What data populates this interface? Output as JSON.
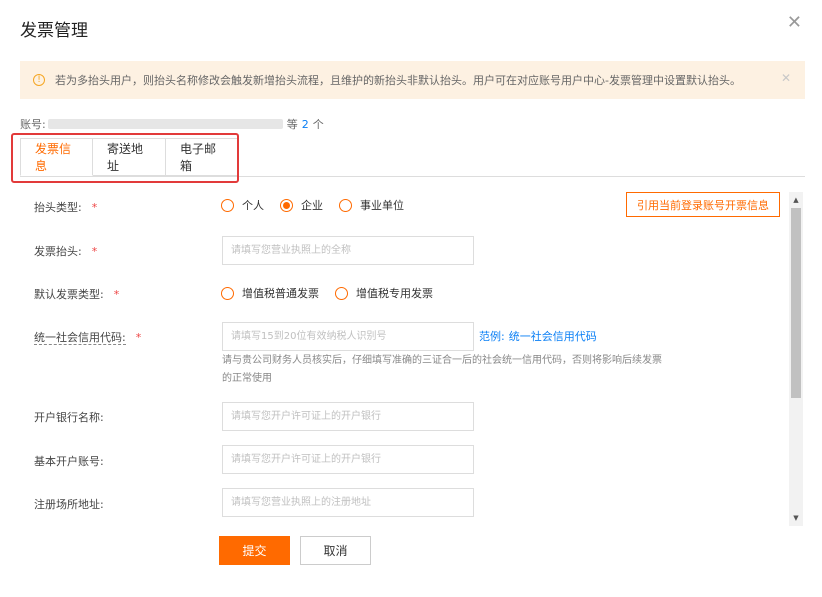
{
  "dialog": {
    "title": "发票管理"
  },
  "alert": {
    "text": "若为多抬头用户，则抬头名称修改会触发新增抬头流程，且维护的新抬头非默认抬头。用户可在对应账号用户中心-发票管理中设置默认抬头。"
  },
  "account": {
    "label": "账号:",
    "suffix_prefix": "等",
    "count": "2",
    "suffix": "个"
  },
  "tabs": [
    {
      "label": "发票信息",
      "active": true
    },
    {
      "label": "寄送地址",
      "active": false
    },
    {
      "label": "电子邮箱",
      "active": false
    }
  ],
  "form": {
    "header_type": {
      "label": "抬头类型:",
      "options": [
        "个人",
        "企业",
        "事业单位"
      ],
      "selected": "企业"
    },
    "ref_button": "引用当前登录账号开票信息",
    "invoice_header": {
      "label": "发票抬头:",
      "placeholder": "请填写您营业执照上的全称"
    },
    "default_type": {
      "label": "默认发票类型:",
      "options": [
        "增值税普通发票",
        "增值税专用发票"
      ]
    },
    "credit_code": {
      "label": "统一社会信用代码:",
      "placeholder": "请填写15到20位有效纳税人识别号",
      "example_prefix": "范例:",
      "example_link": "统一社会信用代码",
      "hint": "请与贵公司财务人员核实后，仔细填写准确的三证合一后的社会统一信用代码，否则将影响后续发票的正常使用"
    },
    "bank_name": {
      "label": "开户银行名称:",
      "placeholder": "请填写您开户许可证上的开户银行"
    },
    "bank_account": {
      "label": "基本开户账号:",
      "placeholder": "请填写您开户许可证上的开户银行"
    },
    "reg_address": {
      "label": "注册场所地址:",
      "placeholder": "请填写您营业执照上的注册地址"
    },
    "required_mark": "*"
  },
  "actions": {
    "submit": "提交",
    "cancel": "取消"
  },
  "colors": {
    "accent": "#ff6a00",
    "link": "#0a7ff5",
    "alert_bg": "#fdf1e2",
    "highlight": "#e23a3a"
  }
}
